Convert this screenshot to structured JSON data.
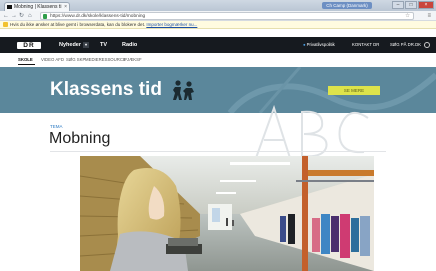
{
  "browser": {
    "tab_title": "Mobning | Klassens ti",
    "tab_close": "×",
    "window_user": "Ch Camp (Danmark)",
    "window_buttons": [
      "–",
      "□",
      "×"
    ],
    "nav_icons": [
      "back-icon",
      "forward-icon",
      "reload-icon",
      "home-icon"
    ],
    "url": "https://www.dr.dk/skole/klassens-tid/mobning",
    "infobar_text": "Hvis du ikke ønsker at blive gemt i browserdata, kan du blokere det. ",
    "infobar_link": "Importer bogmærker nu..."
  },
  "site": {
    "logo": "DR",
    "nav": [
      "Nyheder",
      "TV",
      "Radio"
    ],
    "nav_dropdown_glyph": "▾",
    "right_links": [
      "Privatlivspolitik",
      "KONTAKT DR",
      "SØG PÅ DR.DK"
    ],
    "subnav": [
      "SKOLE",
      "VIDEO AFD",
      "SØG SKP",
      "MEDIERESSOURCE",
      "PJÆKSF"
    ]
  },
  "banner": {
    "title": "Klassens tid",
    "button_label": "SE MERE",
    "background_color": "#5b879b"
  },
  "article": {
    "kicker": "TEMA",
    "headline": "Mobning"
  },
  "colors": {
    "dr_bar": "#161a1f",
    "banner_button": "#dde34b",
    "kicker": "#2e7cc4"
  }
}
